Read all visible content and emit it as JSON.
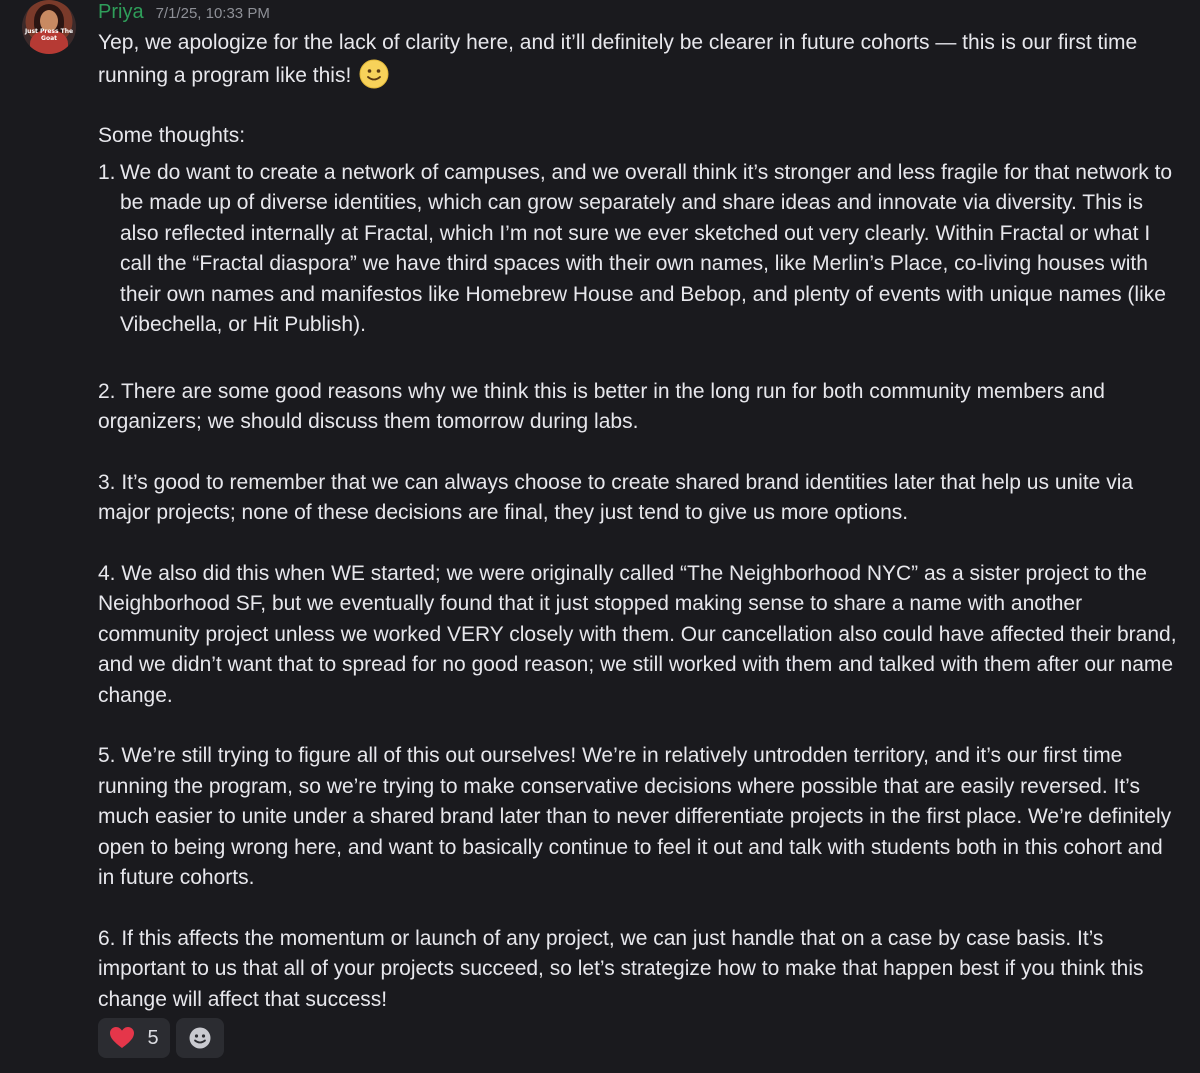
{
  "message": {
    "author": "Priya",
    "timestamp": "7/1/25, 10:33 PM",
    "avatar_text": "Just Press The Goat",
    "intro_line": "Yep, we apologize for the lack of clarity here, and it’ll definitely be clearer in future cohorts  — this is our first time running a program like this!",
    "intro_emoji": "slightly-smiling-face-icon",
    "thoughts_heading": "Some thoughts:",
    "point1_num": "1.",
    "point1": "We do want to create a network of campuses, and we overall think it’s stronger and less fragile for that network to be made up of diverse identities, which can grow separately and share ideas and innovate via diversity. This is also reflected internally at Fractal, which I’m not sure we ever sketched out very clearly. Within Fractal or what I call the “Fractal diaspora” we have third spaces with their own names, like Merlin’s Place, co-living houses with their own names and manifestos like Homebrew House and Bebop, and plenty of events with unique names (like Vibechella, or Hit Publish).",
    "point2": "2. There are some good reasons why we think this is better in the long run for both community members and organizers; we should discuss them tomorrow during labs.",
    "point3": "3. It’s good to remember that we can always choose to create shared brand identities later that help us unite via major projects; none of these decisions are final, they just tend to give us more options.",
    "point4": "4. We also did this when WE started; we were originally called “The Neighborhood NYC” as a sister project to the Neighborhood SF, but we eventually found that it just stopped making sense to share a name with another community project unless we worked VERY closely with them. Our cancellation also could have affected their brand, and we didn’t want that to spread for no good reason; we still worked with them and talked with them after our name change.",
    "point5": "5. We’re still trying to figure all of this out ourselves! We’re in relatively untrodden territory, and it’s our first time running the program, so we’re trying to make conservative decisions where possible that are easily reversed. It’s much easier to unite under a shared brand later than to never differentiate projects in the first place. We’re definitely open to being wrong here, and want to basically continue to feel it out and talk with students both in this cohort and in future cohorts.",
    "point6": "6. If this affects the momentum or launch of any project, we can just handle that on a case by case basis. It’s important to us that all of your projects succeed, so let’s strategize how to make that happen best if you think this change will affect that success!"
  },
  "reactions": [
    {
      "icon": "heart-icon",
      "count": "5",
      "color": "#e5364a"
    },
    {
      "icon": "add-reaction-icon"
    }
  ],
  "colors": {
    "background": "#1a1a1e",
    "username": "#2f9e5a",
    "text": "#e7e7ec",
    "timestamp": "#8e9097",
    "reaction_bg": "#2b2c31"
  }
}
